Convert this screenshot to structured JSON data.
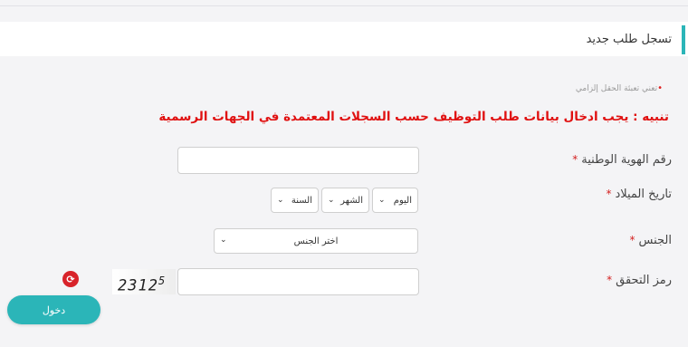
{
  "title": "تسجل طلب جديد",
  "required_note": {
    "star": "•",
    "text": "تعني تعبئة الحقل إلزامي"
  },
  "warning": "تنبيه : يجب ادخال بيانات طلب التوظيف حسب السجلات المعتمدة في الجهات الرسمية",
  "fields": {
    "national_id": {
      "label": "رقم الهوية الوطنية",
      "star": "*",
      "value": ""
    },
    "birth_date": {
      "label": "تاريخ الميلاد",
      "star": "*",
      "day": "اليوم",
      "month": "الشهر",
      "year": "السنة"
    },
    "gender": {
      "label": "الجنس",
      "star": "*",
      "placeholder": "اختر الجنس"
    },
    "captcha": {
      "label": "رمز التحقق",
      "star": "*",
      "code_main": "2312",
      "code_sup": "5",
      "value": ""
    }
  },
  "login_button": "دخول",
  "colors": {
    "accent": "#2bb5b8",
    "warning": "#e01010",
    "required": "#d42020"
  },
  "icons": {
    "chevron": "chevron-down-icon",
    "refresh": "refresh-icon"
  }
}
